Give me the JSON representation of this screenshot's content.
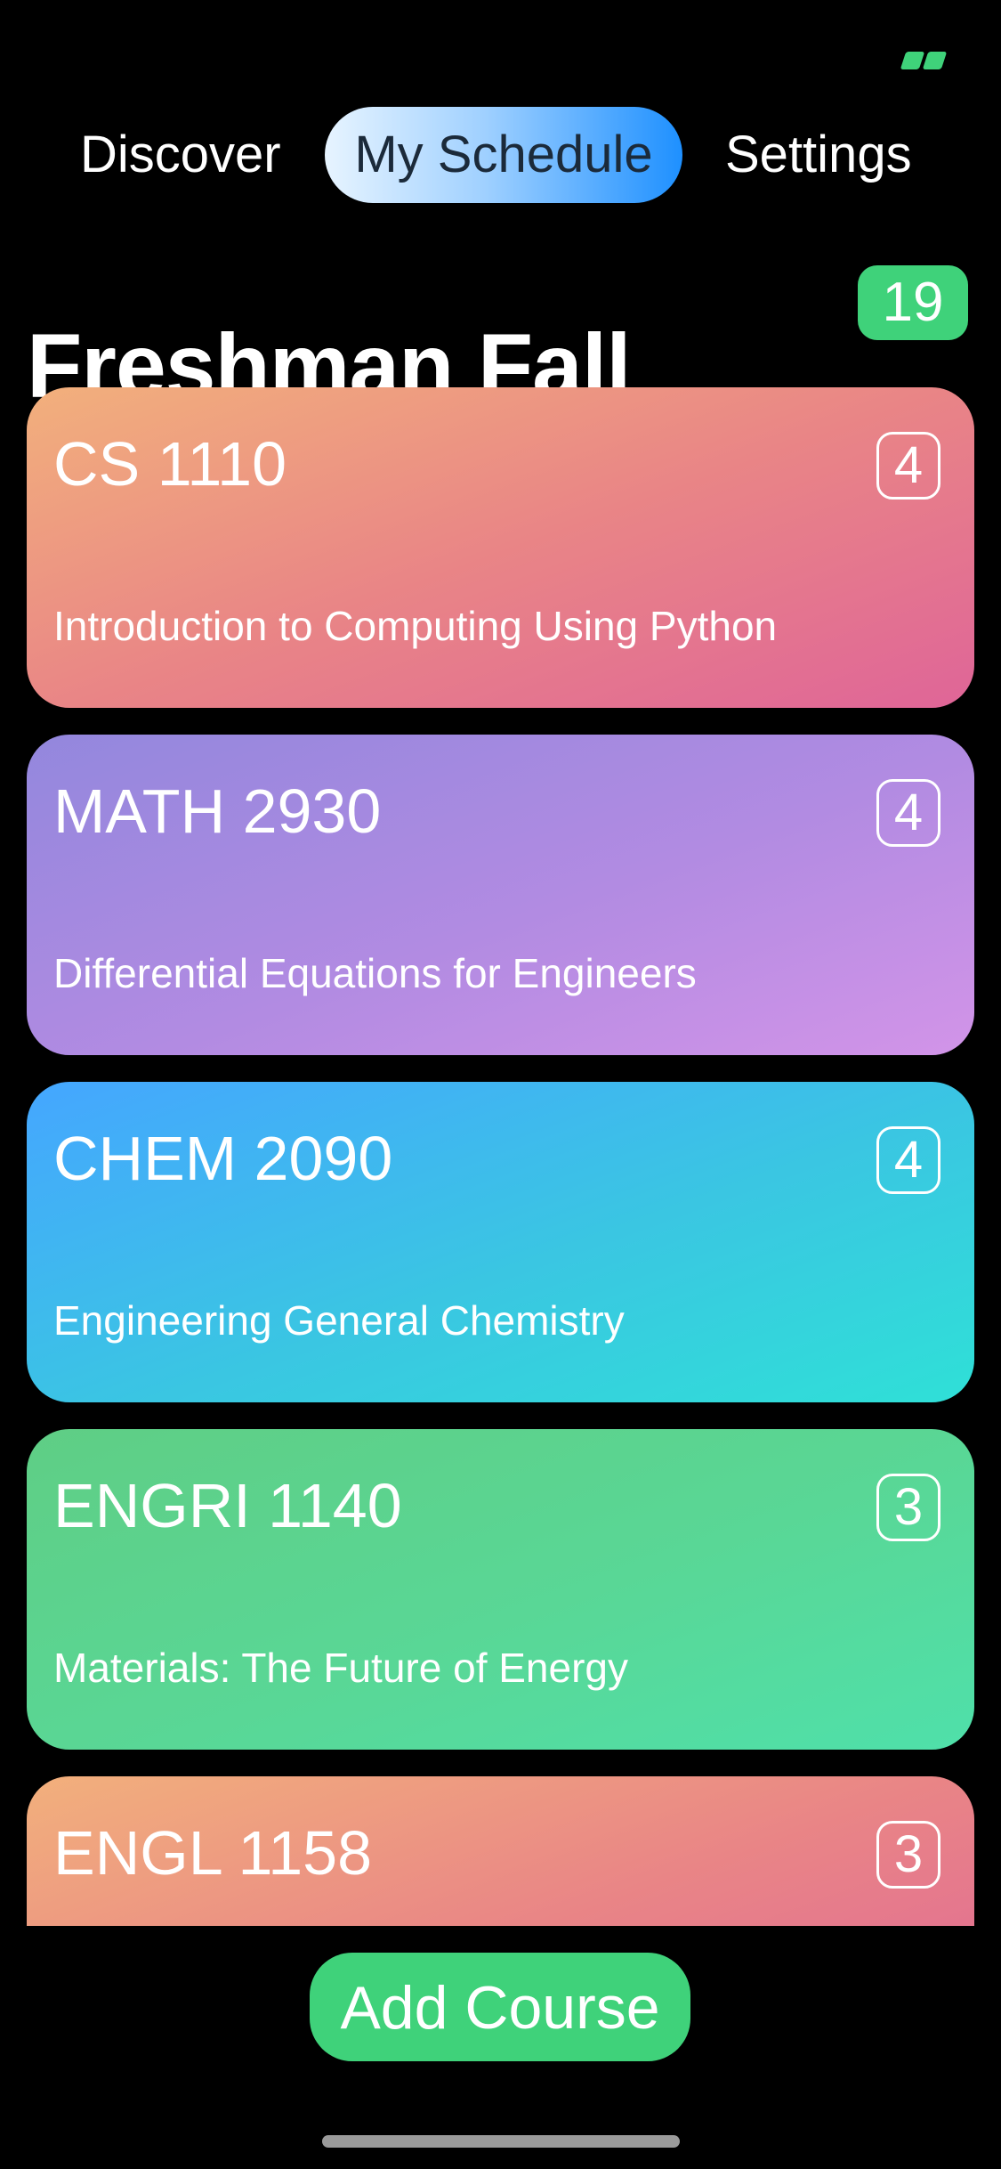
{
  "nav": {
    "tabs": [
      {
        "label": "Discover"
      },
      {
        "label": "My Schedule"
      },
      {
        "label": "Settings"
      }
    ],
    "active_tab": "My Schedule"
  },
  "schedule": {
    "title": "Freshman Fall",
    "total_credits": "19"
  },
  "courses": [
    {
      "code": "CS 1110",
      "credits": "4",
      "title": "Introduction to Computing Using Python",
      "color": "#e98586"
    },
    {
      "code": "MATH 2930",
      "credits": "4",
      "title": "Differential Equations for Engineers",
      "color": "#b28be2"
    },
    {
      "code": "CHEM 2090",
      "credits": "4",
      "title": "Engineering General Chemistry",
      "color": "#3ac6e2"
    },
    {
      "code": "ENGRI 1140",
      "credits": "3",
      "title": "Materials: The Future of Energy",
      "color": "#59d796"
    },
    {
      "code": "ENGL 1158",
      "credits": "3",
      "title": "",
      "color": "#e98586"
    }
  ],
  "actions": {
    "add_course_label": "Add Course"
  },
  "colors": {
    "accent_green": "#3fd27a",
    "active_tab_blue": "#1e90ff",
    "background": "#000000"
  },
  "icons": {
    "status_battery": "battery-charging-icon"
  }
}
